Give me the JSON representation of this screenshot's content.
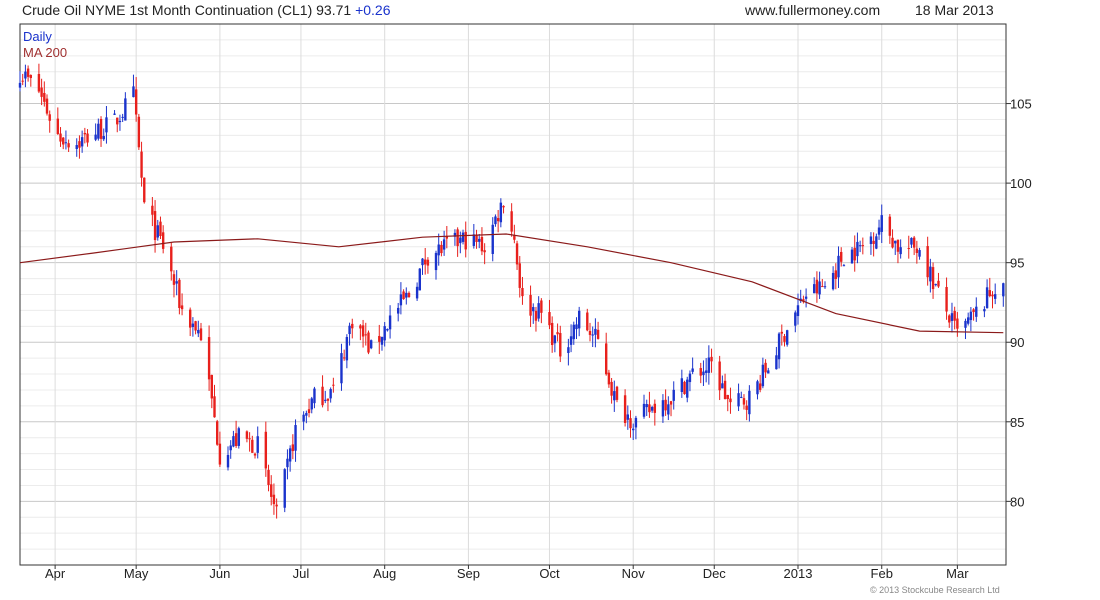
{
  "header": {
    "title": "Crude Oil NYME 1st Month Continuation (CL1) 93.71",
    "change": "+0.26",
    "site": "www.fullermoney.com",
    "date": "18 Mar 2013"
  },
  "footer": {
    "copyright": "© 2013 Stockcube Research Ltd"
  },
  "colors": {
    "up": "#1a33cc",
    "down": "#e8201c",
    "ma": "#8b1a1a",
    "grid": "#dddddd",
    "axis": "#333333"
  },
  "chart_data": {
    "type": "candlestick",
    "legend": [
      {
        "label": "Daily",
        "color": "#1a33cc"
      },
      {
        "label": "MA 200",
        "color": "#a03030"
      }
    ],
    "legend_position": "top-left",
    "grid": true,
    "y_axis_side": "right",
    "ylim": [
      76,
      110
    ],
    "y_ticks": [
      80,
      85,
      90,
      95,
      100,
      105
    ],
    "x_ticks": [
      "Apr",
      "May",
      "Jun",
      "Jul",
      "Aug",
      "Sep",
      "Oct",
      "Nov",
      "Dec",
      "2013",
      "Feb",
      "Mar"
    ],
    "x_tick_dates": [
      "2012-04-01",
      "2012-05-01",
      "2012-06-01",
      "2012-07-01",
      "2012-08-01",
      "2012-09-01",
      "2012-10-01",
      "2012-11-01",
      "2012-12-01",
      "2013-01-01",
      "2013-02-01",
      "2013-03-01"
    ],
    "xlim": [
      "2012-03-19",
      "2013-03-19"
    ],
    "price_path": [
      [
        "2012-03-19",
        107.0
      ],
      [
        "2012-03-26",
        105.8
      ],
      [
        "2012-04-02",
        103.0
      ],
      [
        "2012-04-09",
        102.5
      ],
      [
        "2012-04-16",
        103.2
      ],
      [
        "2012-04-23",
        103.8
      ],
      [
        "2012-04-30",
        105.5
      ],
      [
        "2012-05-04",
        98.5
      ],
      [
        "2012-05-11",
        96.0
      ],
      [
        "2012-05-18",
        92.0
      ],
      [
        "2012-05-25",
        90.5
      ],
      [
        "2012-06-01",
        83.0
      ],
      [
        "2012-06-08",
        84.0
      ],
      [
        "2012-06-15",
        83.5
      ],
      [
        "2012-06-22",
        79.0
      ],
      [
        "2012-06-29",
        84.5
      ],
      [
        "2012-07-06",
        86.5
      ],
      [
        "2012-07-13",
        87.0
      ],
      [
        "2012-07-20",
        91.5
      ],
      [
        "2012-07-27",
        89.5
      ],
      [
        "2012-08-03",
        91.5
      ],
      [
        "2012-08-10",
        93.0
      ],
      [
        "2012-08-17",
        95.5
      ],
      [
        "2012-08-24",
        96.0
      ],
      [
        "2012-08-31",
        96.5
      ],
      [
        "2012-09-07",
        96.0
      ],
      [
        "2012-09-14",
        99.0
      ],
      [
        "2012-09-18",
        96.5
      ],
      [
        "2012-09-21",
        92.5
      ],
      [
        "2012-09-28",
        91.8
      ],
      [
        "2012-10-05",
        89.5
      ],
      [
        "2012-10-12",
        91.5
      ],
      [
        "2012-10-19",
        90.0
      ],
      [
        "2012-10-26",
        86.0
      ],
      [
        "2012-11-02",
        85.0
      ],
      [
        "2012-11-09",
        86.0
      ],
      [
        "2012-11-16",
        86.7
      ],
      [
        "2012-11-23",
        88.0
      ],
      [
        "2012-11-30",
        88.5
      ],
      [
        "2012-12-07",
        86.0
      ],
      [
        "2012-12-14",
        86.5
      ],
      [
        "2012-12-21",
        88.5
      ],
      [
        "2012-12-28",
        91.0
      ],
      [
        "2013-01-04",
        93.0
      ],
      [
        "2013-01-11",
        93.5
      ],
      [
        "2013-01-18",
        95.5
      ],
      [
        "2013-01-25",
        96.0
      ],
      [
        "2013-02-01",
        97.5
      ],
      [
        "2013-02-08",
        95.8
      ],
      [
        "2013-02-15",
        96.0
      ],
      [
        "2013-02-22",
        93.0
      ],
      [
        "2013-03-01",
        90.5
      ],
      [
        "2013-03-08",
        91.8
      ],
      [
        "2013-03-15",
        93.5
      ],
      [
        "2013-03-18",
        93.71
      ]
    ],
    "ma200_path": [
      [
        "2012-03-19",
        95.0
      ],
      [
        "2012-04-15",
        95.6
      ],
      [
        "2012-05-15",
        96.3
      ],
      [
        "2012-06-15",
        96.5
      ],
      [
        "2012-07-15",
        96.0
      ],
      [
        "2012-08-15",
        96.6
      ],
      [
        "2012-09-15",
        96.8
      ],
      [
        "2012-10-15",
        96.0
      ],
      [
        "2012-11-15",
        95.0
      ],
      [
        "2012-12-15",
        93.8
      ],
      [
        "2013-01-15",
        91.8
      ],
      [
        "2013-02-15",
        90.7
      ],
      [
        "2013-03-18",
        90.6
      ]
    ]
  }
}
